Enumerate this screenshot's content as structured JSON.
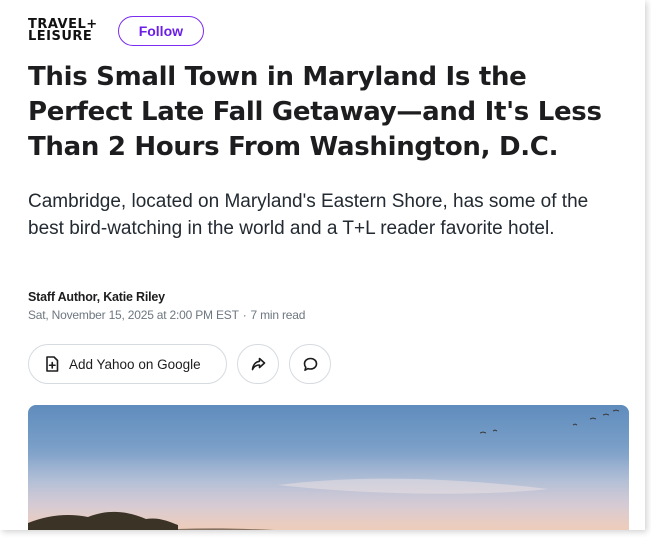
{
  "publisher": {
    "logo_line1": "TRAVEL+",
    "logo_line2": "LEISURE",
    "follow_label": "Follow",
    "accent_color": "#6a1ee8"
  },
  "article": {
    "headline": "This Small Town in Maryland Is the Perfect Late Fall Getaway—and It's Less Than 2 Hours From Washington, D.C.",
    "subhead": "Cambridge, located on Maryland's Eastern Shore, has some of the best bird-watching in the world and a T+L reader favorite hotel.",
    "author": "Staff Author, Katie Riley",
    "date": "Sat, November 15, 2025 at 2:00 PM EST",
    "read_time": "7 min read"
  },
  "actions": {
    "add_source_label": "Add Yahoo on Google",
    "add_source_icon": "add-document-icon",
    "share_icon": "share-icon",
    "comment_icon": "comment-icon"
  },
  "hero_image": {
    "alt_description": ""
  }
}
